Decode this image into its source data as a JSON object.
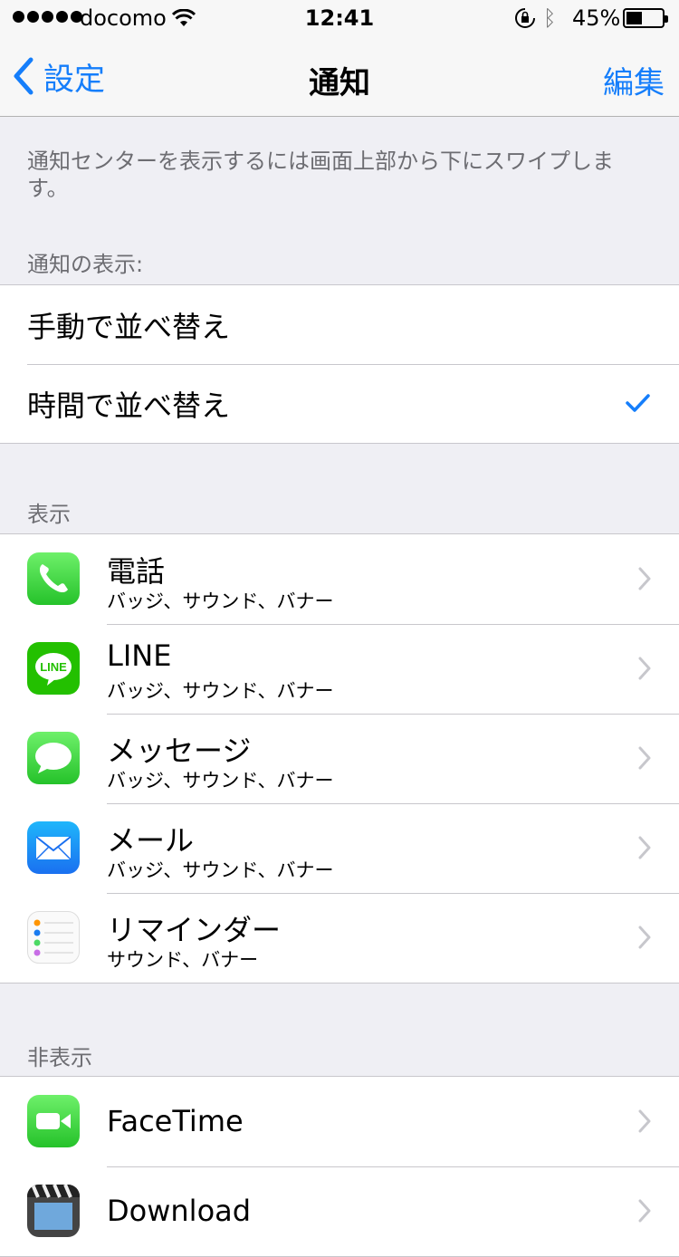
{
  "status_bar": {
    "carrier": "docomo",
    "time": "12:41",
    "battery_percent": "45%",
    "battery_level": 0.45
  },
  "nav": {
    "back_label": "設定",
    "title": "通知",
    "edit_label": "編集"
  },
  "note": "通知センターを表示するには画面上部から下にスワイプします。",
  "sort_section": {
    "header": "通知の表示:",
    "options": [
      {
        "label": "手動で並べ替え",
        "selected": false
      },
      {
        "label": "時間で並べ替え",
        "selected": true
      }
    ]
  },
  "shown_section": {
    "header": "表示",
    "apps": [
      {
        "name": "電話",
        "detail": "バッジ、サウンド、バナー",
        "icon": "phone-icon"
      },
      {
        "name": "LINE",
        "detail": "バッジ、サウンド、バナー",
        "icon": "line-icon",
        "icon_text": "LINE"
      },
      {
        "name": "メッセージ",
        "detail": "バッジ、サウンド、バナー",
        "icon": "messages-icon"
      },
      {
        "name": "メール",
        "detail": "バッジ、サウンド、バナー",
        "icon": "mail-icon"
      },
      {
        "name": "リマインダー",
        "detail": "サウンド、バナー",
        "icon": "reminders-icon"
      }
    ]
  },
  "hidden_section": {
    "header": "非表示",
    "apps": [
      {
        "name": "FaceTime",
        "icon": "facetime-icon"
      },
      {
        "name": "Download",
        "icon": "download-icon"
      }
    ]
  },
  "colors": {
    "accent": "#157efb",
    "background": "#efeff4",
    "separator": "#c8c7cc",
    "secondary_text": "#6d6d72"
  }
}
